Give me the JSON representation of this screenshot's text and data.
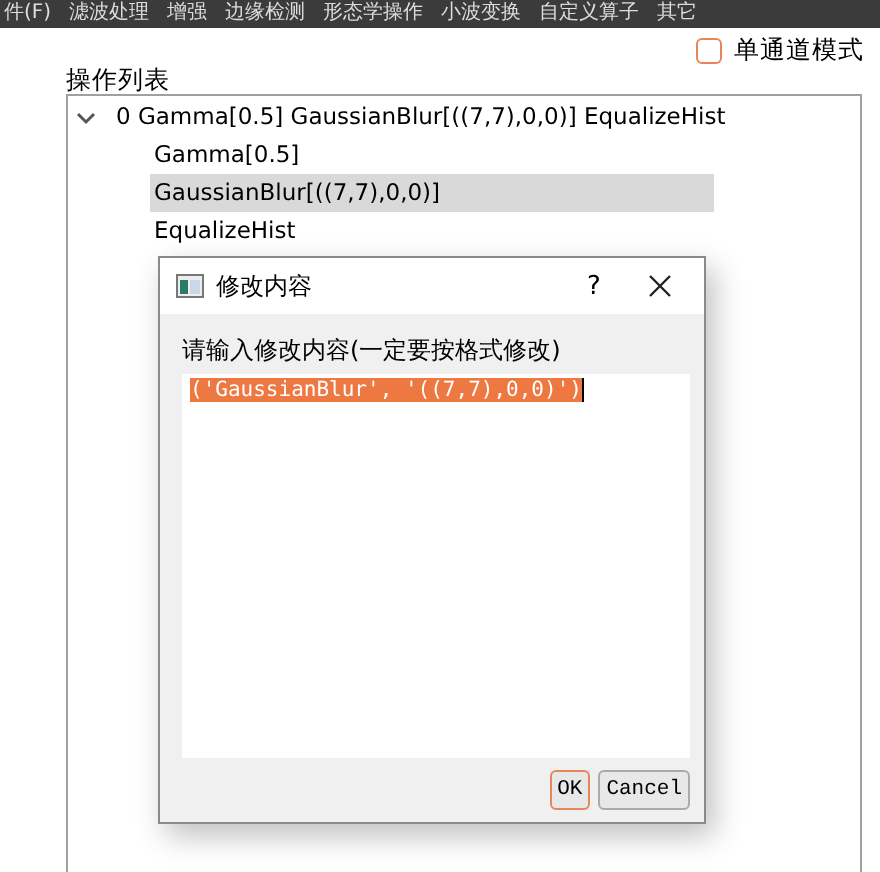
{
  "menu_bar": {
    "items": [
      "件(F)",
      "滤波处理",
      "增强",
      "边缘检测",
      "形态学操作",
      "小波变换",
      "自定义算子",
      "其它"
    ]
  },
  "single_channel_mode": {
    "label": "单通道模式",
    "checked": false
  },
  "operation_list": {
    "title": "操作列表",
    "tree": [
      {
        "label": "0 Gamma[0.5] GaussianBlur[((7,7),0,0)] EqualizeHist",
        "expanded": true,
        "selected": false,
        "children": [
          {
            "label": "Gamma[0.5]",
            "selected": false
          },
          {
            "label": "GaussianBlur[((7,7),0,0)]",
            "selected": true
          },
          {
            "label": "EqualizeHist",
            "selected": false
          }
        ]
      }
    ]
  },
  "dialog": {
    "title": "修改内容",
    "help": "?",
    "prompt": "请输入修改内容(一定要按格式修改)",
    "value": "('GaussianBlur', '((7,7),0,0)')",
    "value_selected": true,
    "buttons": [
      {
        "label": "OK",
        "focused": true
      },
      {
        "label": "Cancel",
        "focused": false
      }
    ]
  }
}
